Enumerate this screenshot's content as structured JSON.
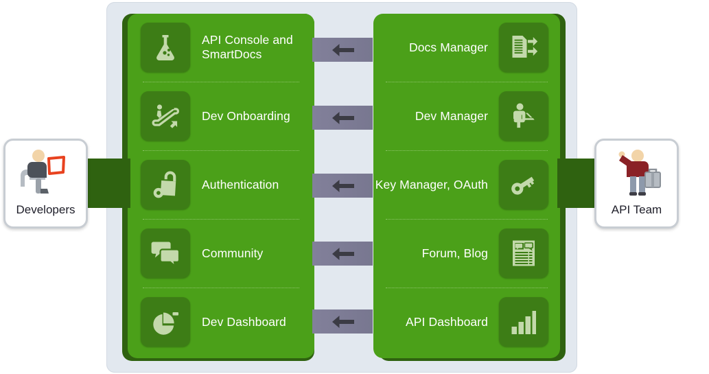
{
  "diagram": {
    "title": "API platform developer / API team capability map",
    "colors": {
      "panel_bg": "#e2e8ef",
      "column_green": "#4ba019",
      "column_shadow_green": "#2f6210",
      "tile_green": "#3d7d16",
      "icon_glyph": "#c3d9ab",
      "arrow_band": "#7f7e97",
      "arrow_glyph": "#3b3b44",
      "label_white": "#ffffff",
      "actor_border": "#c8cdd3"
    }
  },
  "actors": {
    "left": {
      "label": "Developers",
      "icon": "developer-at-laptop-icon"
    },
    "right": {
      "label": "API Team",
      "icon": "api-team-person-icon"
    }
  },
  "left_column": {
    "items": [
      {
        "label": "API Console and SmartDocs",
        "icon": "flask-icon"
      },
      {
        "label": "Dev Onboarding",
        "icon": "escalator-icon"
      },
      {
        "label": "Authentication",
        "icon": "padlock-key-icon"
      },
      {
        "label": "Community",
        "icon": "speech-bubbles-icon"
      },
      {
        "label": "Dev Dashboard",
        "icon": "pie-chart-icon"
      }
    ]
  },
  "right_column": {
    "items": [
      {
        "label": "Docs Manager",
        "icon": "document-arrows-icon"
      },
      {
        "label": "Dev Manager",
        "icon": "seated-person-laptop-icon"
      },
      {
        "label": "Key Manager, OAuth",
        "icon": "key-icon"
      },
      {
        "label": "Forum,  Blog",
        "icon": "forum-page-icon"
      },
      {
        "label": "API Dashboard",
        "icon": "bar-chart-icon"
      }
    ]
  },
  "arrows": [
    {
      "direction": "left",
      "icon": "arrow-left-icon"
    },
    {
      "direction": "left",
      "icon": "arrow-left-icon"
    },
    {
      "direction": "left",
      "icon": "arrow-left-icon"
    },
    {
      "direction": "left",
      "icon": "arrow-left-icon"
    },
    {
      "direction": "left",
      "icon": "arrow-left-icon"
    }
  ]
}
